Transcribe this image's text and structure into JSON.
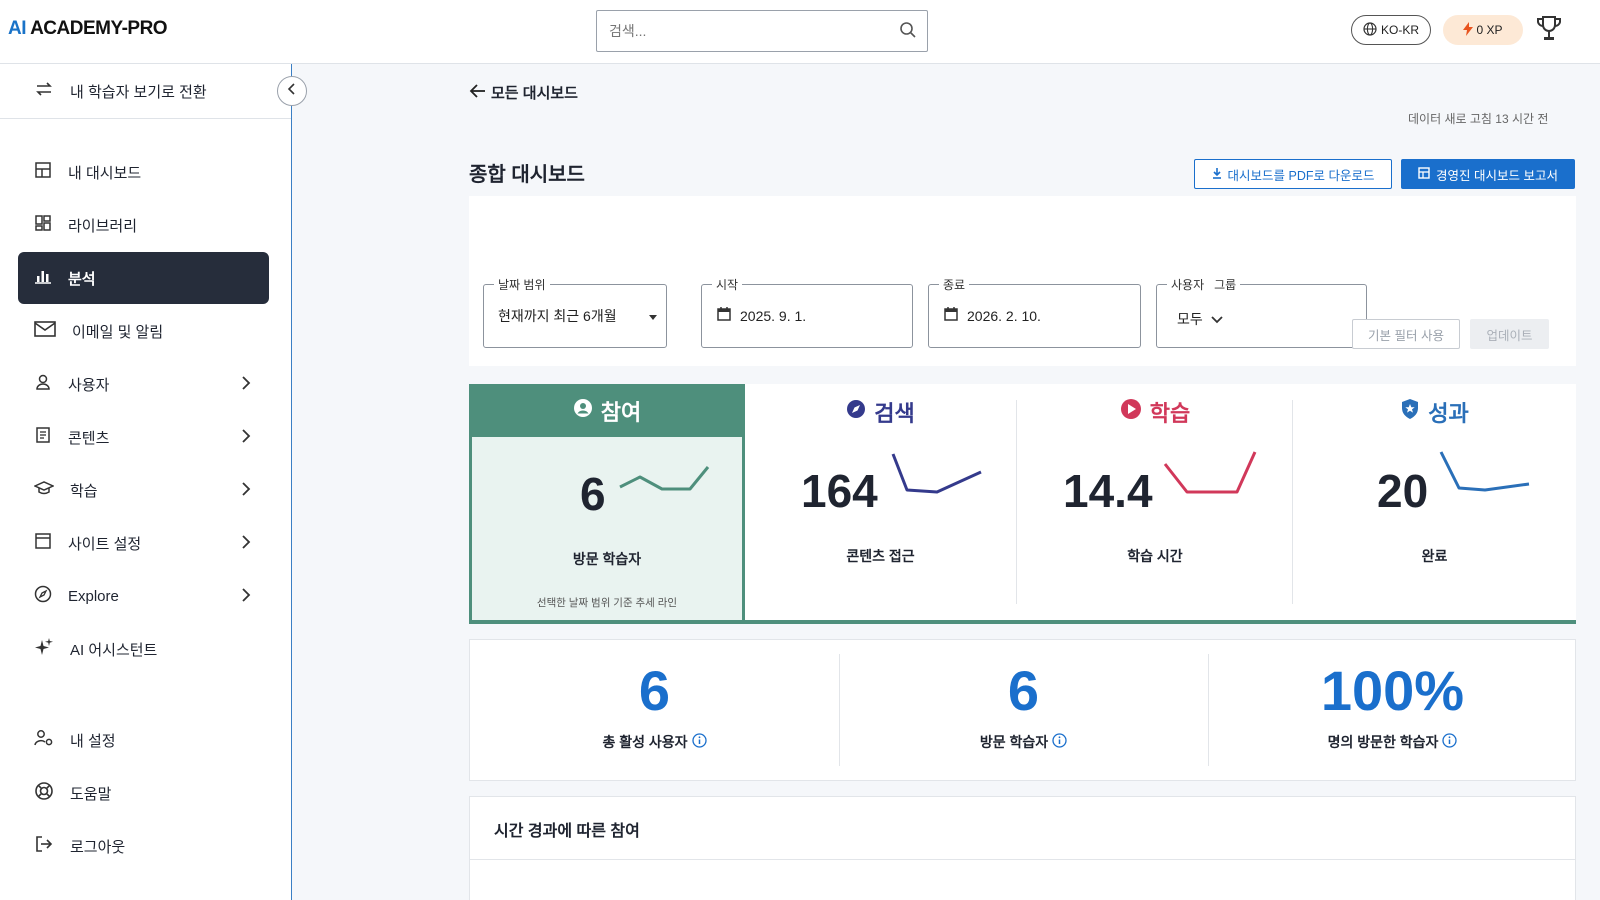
{
  "header": {
    "logo_ai": "AI",
    "logo_text": "ACADEMY-PRO",
    "search_placeholder": "검색...",
    "language": "KO-KR",
    "xp": "0 XP"
  },
  "sidebar": {
    "switch_view": "내 학습자 보기로 전환",
    "items": [
      {
        "label": "내 대시보드"
      },
      {
        "label": "라이브러리"
      },
      {
        "label": "분석"
      },
      {
        "label": "이메일 및 알림"
      },
      {
        "label": "사용자"
      },
      {
        "label": "콘텐츠"
      },
      {
        "label": "학습"
      },
      {
        "label": "사이트 설정"
      },
      {
        "label": "Explore"
      },
      {
        "label": "AI 어시스턴트"
      },
      {
        "label": "내 설정"
      },
      {
        "label": "도움말"
      },
      {
        "label": "로그아웃"
      }
    ]
  },
  "main": {
    "back": "모든 대시보드",
    "refresh": "데이터 새로 고침 13 시간 전",
    "title": "종합 대시보드",
    "btn_pdf": "대시보드를 PDF로 다운로드",
    "btn_exec": "경영진 대시보드 보고서",
    "filters": {
      "date_range_label": "날짜 범위",
      "date_range_value": "현재까지 최근 6개월",
      "start_label": "시작",
      "start_value": "2025. 9. 1.",
      "end_label": "종료",
      "end_value": "2026. 2. 10.",
      "group_label": "사용자   그룹",
      "group_value": "모두",
      "btn_default": "기본 필터 사용",
      "btn_update": "업데이트"
    },
    "kpis": [
      {
        "head": "참여",
        "value": "6",
        "label": "방문 학습자",
        "note": "선택한 날짜 범위 기준 추세 라인",
        "color": "#4e8f7c"
      },
      {
        "head": "검색",
        "value": "164",
        "label": "콘텐츠 접근",
        "color": "#343a8c"
      },
      {
        "head": "학습",
        "value": "14.4",
        "label": "학습 시간",
        "color": "#d1385a"
      },
      {
        "head": "성과",
        "value": "20",
        "label": "완료",
        "color": "#2a6fb8"
      }
    ],
    "summary": [
      {
        "value": "6",
        "label": "총 활성 사용자"
      },
      {
        "value": "6",
        "label": "방문 학습자"
      },
      {
        "value": "100%",
        "label": "명의 방문한 학습자"
      }
    ],
    "section_title": "시간 경과에 따른 참여"
  }
}
